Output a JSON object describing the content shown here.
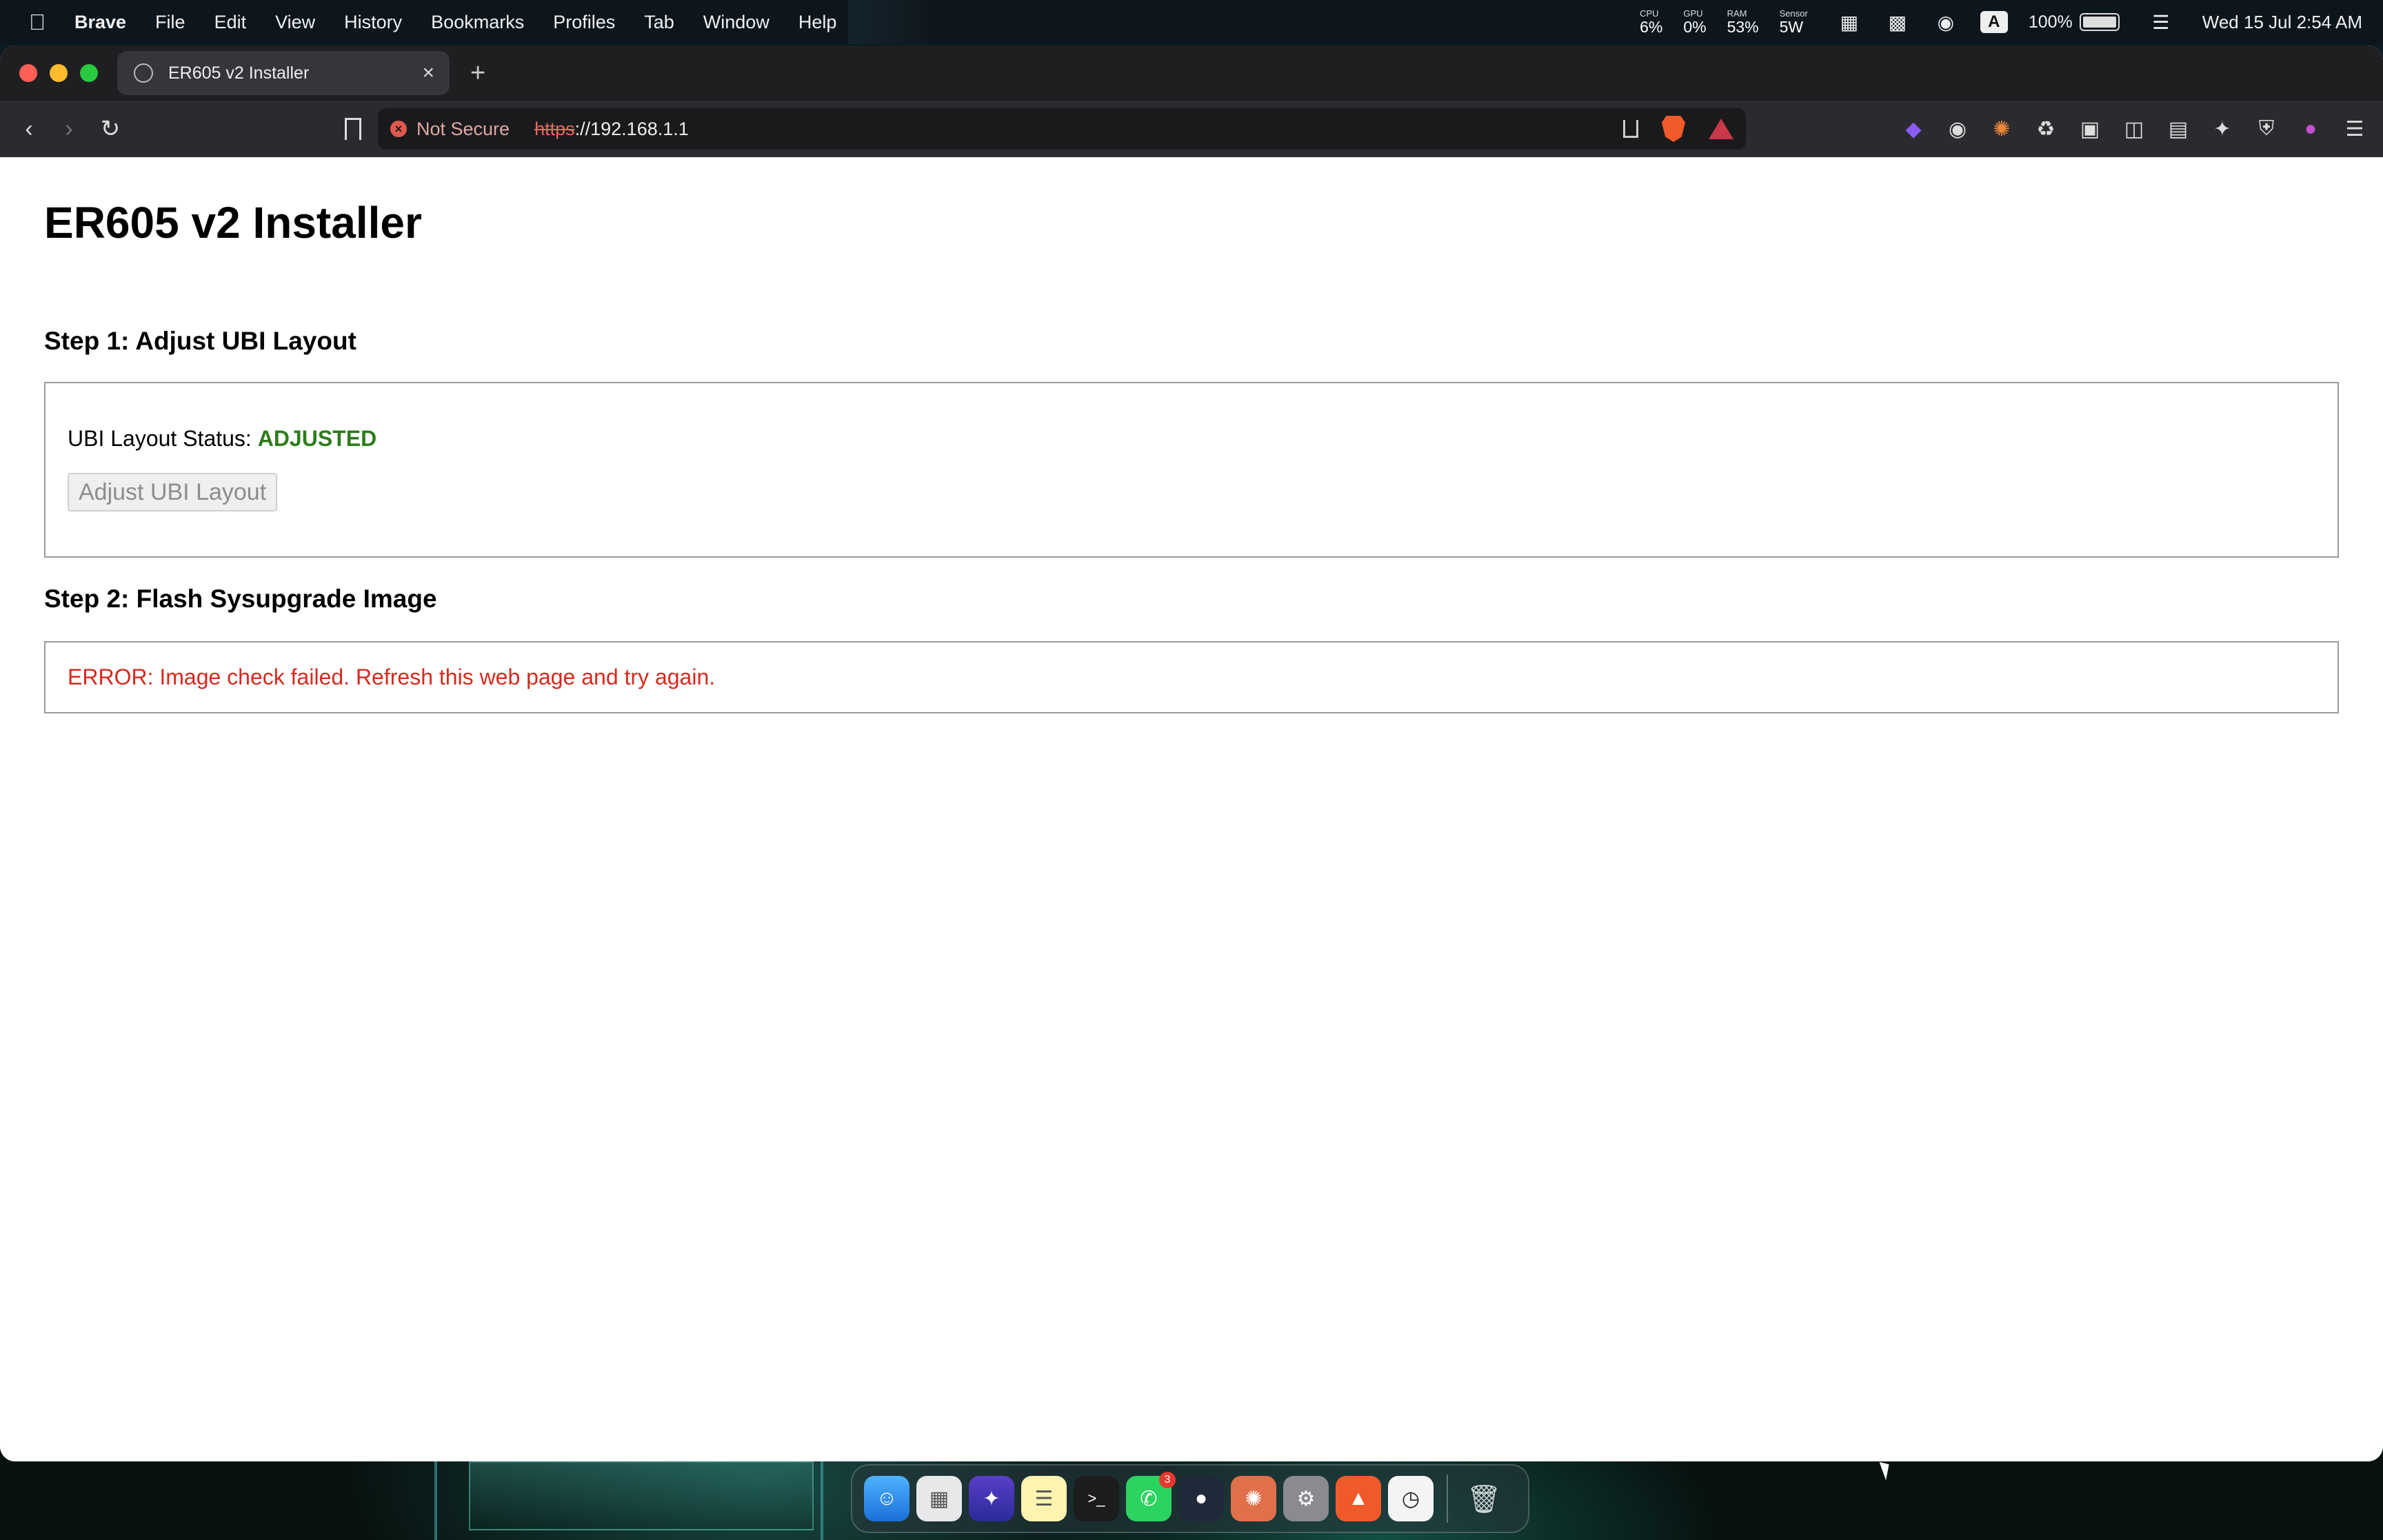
{
  "menubar": {
    "app_name": "Brave",
    "menus": [
      "File",
      "Edit",
      "View",
      "History",
      "Bookmarks",
      "Profiles",
      "Tab",
      "Window",
      "Help"
    ],
    "stats": [
      {
        "label": "CPU",
        "value": "6%"
      },
      {
        "label": "GPU",
        "value": "0%"
      },
      {
        "label": "RAM",
        "value": "53%"
      },
      {
        "label": "Sensor",
        "value": "5W"
      }
    ],
    "battery_percent": "100%",
    "clock": "Wed 15 Jul  2:54 AM"
  },
  "browser": {
    "tab_title": "ER605 v2 Installer",
    "new_tab_symbol": "+",
    "security_label": "Not Secure",
    "url_scheme": "https",
    "url_rest": "://192.168.1.1"
  },
  "page": {
    "title": "ER605 v2 Installer",
    "step1_title": "Step 1: Adjust UBI Layout",
    "ubi_status_label": "UBI Layout Status: ",
    "ubi_status_value": "ADJUSTED",
    "adjust_button_label": "Adjust UBI Layout",
    "step2_title": "Step 2: Flash Sysupgrade Image",
    "error_message": "ERROR: Image check failed. Refresh this web page and try again."
  },
  "dock": {
    "whatsapp_badge": "3"
  },
  "colors": {
    "status_ok": "#2e7d1c",
    "error": "#d62a1e",
    "brave_orange": "#f05a2a"
  }
}
